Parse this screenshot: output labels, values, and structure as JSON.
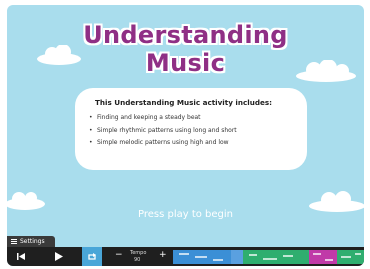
{
  "title_line1": "Understanding",
  "title_line2": "Music",
  "card": {
    "heading": "This Understanding Music activity includes:",
    "items": [
      "Finding and keeping a steady beat",
      "Simple rhythmic patterns using long and short",
      "Simple melodic patterns using high and low"
    ]
  },
  "prompt": "Press play to begin",
  "settings_label": "Settings",
  "tempo": {
    "label": "Tempo",
    "value": "90"
  },
  "icons": {
    "skip_start": "skip-to-start-icon",
    "play": "play-icon",
    "loop": "loop-icon",
    "minus": "minus-icon",
    "plus": "plus-icon",
    "menu": "hamburger-icon"
  },
  "colors": {
    "sky": "#a9dded",
    "title": "#8f2f85",
    "loop_active": "#4aa6d8",
    "segment_blue": "#3b8fd6",
    "segment_green": "#2fae6f",
    "segment_magenta": "#c03aa8"
  }
}
